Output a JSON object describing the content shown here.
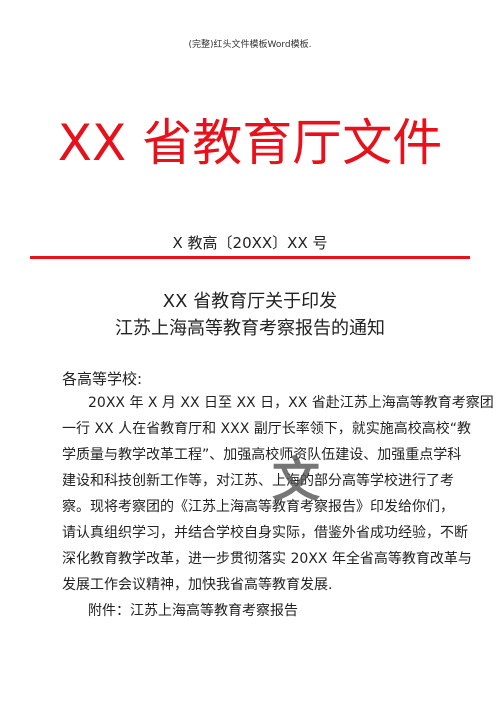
{
  "header": "(完整)红头文件模板Word模板.",
  "red_title": "XX 省教育厅文件",
  "doc_number": "X 教高〔20XX〕XX 号",
  "title_line1": "XX 省教育厅关于印发",
  "title_line2": "江苏上海高等教育考察报告的通知",
  "salutation": "各高等学校:",
  "body_lines": [
    "20XX 年 X 月 XX 日至 XX 日，XX 省赴江苏上海高等教育考察团",
    "一行 XX 人在省教育厅和 XXX 副厅长率领下，就实施高校高校“教",
    "学质量与教学改革工程”、加强高校师资队伍建设、加强重点学科",
    "建设和科技创新工作等，对江苏、上海的部分高等学校进行了考",
    "察。现将考察团的《江苏上海高等教育考察报告》印发给你们，",
    "请认真组织学习，并结合学校自身实际，借鉴外省成功经验，不断",
    "深化教育教学改革，进一步贯彻落实 20XX 年全省高等教育改革与",
    "发展工作会议精神，加快我省高等教育发展."
  ],
  "attachment": "附件：江苏上海高等教育考察报告",
  "watermark": "文",
  "colors": {
    "red": "#e8101a"
  }
}
